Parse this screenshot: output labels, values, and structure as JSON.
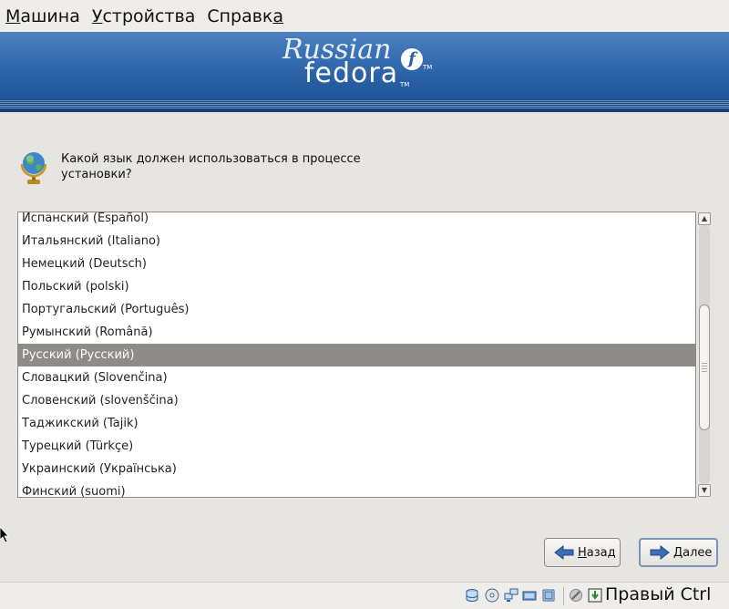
{
  "menubar": {
    "items": [
      {
        "accel": "М",
        "rest": "ашина"
      },
      {
        "accel": "У",
        "rest": "стройства"
      },
      {
        "pre": "Справк",
        "accel": "а"
      }
    ]
  },
  "banner": {
    "logo_top": "Russian",
    "logo_bottom": "fedora",
    "logo_mark": "f",
    "tm": "TM"
  },
  "installer": {
    "question": "Какой язык должен использоваться в процессе установки?",
    "languages": [
      "Испанский (Español)",
      "Итальянский (Italiano)",
      "Немецкий (Deutsch)",
      "Польский (polski)",
      "Португальский (Português)",
      "Румынский (Română)",
      "Русский (Русский)",
      "Словацкий (Slovenčina)",
      "Словенский (slovenščina)",
      "Таджикский (Tajik)",
      "Турецкий (Türkçe)",
      "Украинский (Українська)",
      "Финский (suomi)"
    ],
    "selected_language": "Русский (Русский)",
    "back_button": {
      "accel": "Н",
      "rest": "азад"
    },
    "next_button": {
      "accel": "Д",
      "rest": "алее"
    }
  },
  "statusbar": {
    "host_key": "Правый Ctrl",
    "icons": [
      "hard-disk-icon",
      "optical-drive-icon",
      "network-icon",
      "usb-icon",
      "shared-folder-icon",
      "capture-icon",
      "mouse-integration-icon",
      "host-key-icon"
    ]
  }
}
